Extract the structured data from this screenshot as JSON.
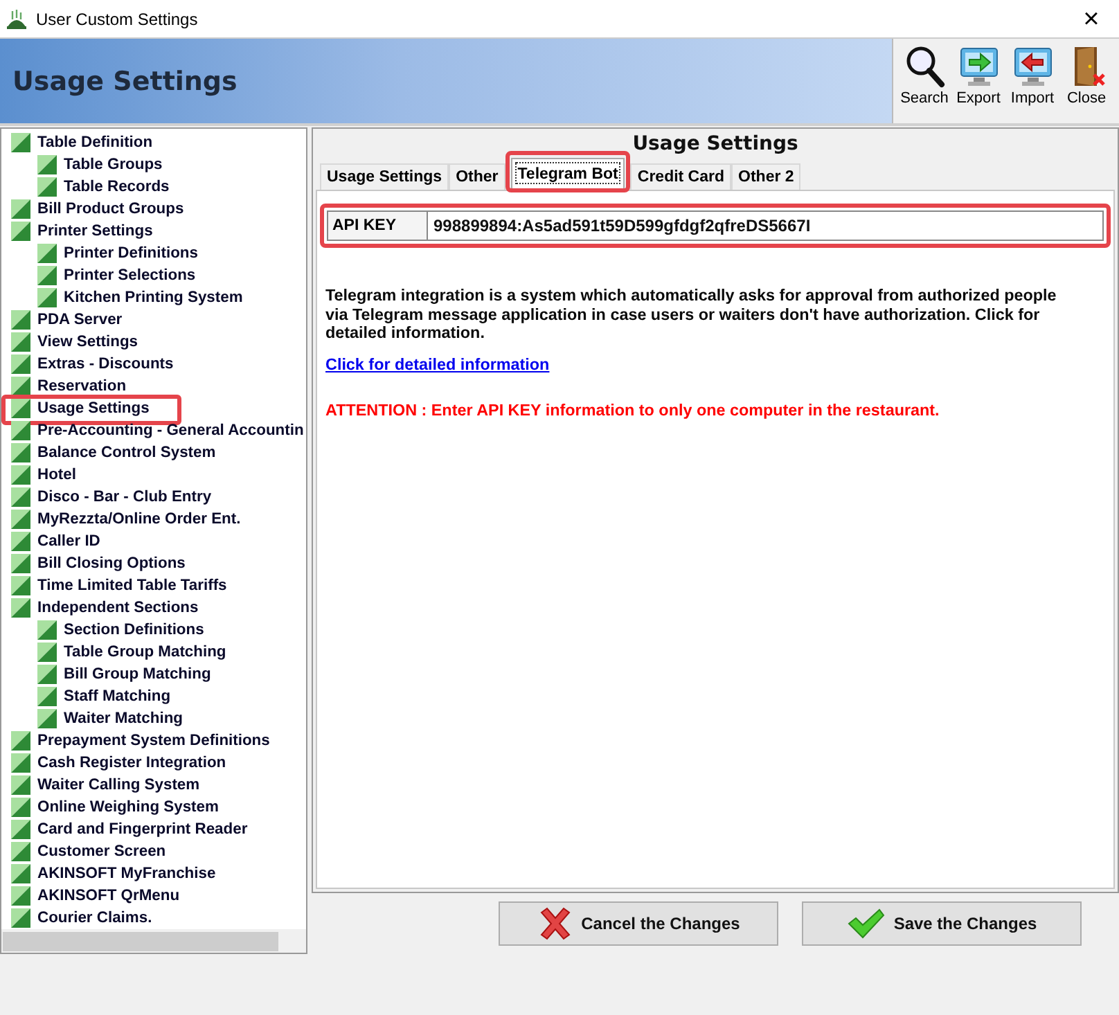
{
  "window": {
    "title": "User Custom Settings",
    "close": "×"
  },
  "header": {
    "title": "Usage Settings",
    "tools": [
      {
        "label": "Search",
        "kind": "search"
      },
      {
        "label": "Export",
        "kind": "export"
      },
      {
        "label": "Import",
        "kind": "import"
      },
      {
        "label": "Close",
        "kind": "close"
      }
    ]
  },
  "sidebar": {
    "items": [
      {
        "label": "Table Definition",
        "highlighted": false,
        "children": [
          {
            "label": "Table Groups",
            "highlighted": false
          },
          {
            "label": "Table Records",
            "highlighted": false
          }
        ]
      },
      {
        "label": "Bill Product Groups",
        "highlighted": false
      },
      {
        "label": "Printer Settings",
        "highlighted": false,
        "children": [
          {
            "label": "Printer Definitions",
            "highlighted": false
          },
          {
            "label": "Printer Selections",
            "highlighted": false
          },
          {
            "label": "Kitchen Printing System",
            "highlighted": false
          }
        ]
      },
      {
        "label": "PDA Server",
        "highlighted": false
      },
      {
        "label": "View Settings",
        "highlighted": false
      },
      {
        "label": "Extras - Discounts",
        "highlighted": false
      },
      {
        "label": "Reservation",
        "highlighted": false
      },
      {
        "label": "Usage Settings",
        "highlighted": true
      },
      {
        "label": "Pre-Accounting - General Accountin",
        "highlighted": false
      },
      {
        "label": "Balance Control System",
        "highlighted": false
      },
      {
        "label": "Hotel",
        "highlighted": false
      },
      {
        "label": "Disco - Bar - Club Entry",
        "highlighted": false
      },
      {
        "label": "MyRezzta/Online Order Ent.",
        "highlighted": false
      },
      {
        "label": "Caller ID",
        "highlighted": false
      },
      {
        "label": "Bill Closing Options",
        "highlighted": false
      },
      {
        "label": "Time Limited Table Tariffs",
        "highlighted": false
      },
      {
        "label": "Independent Sections",
        "highlighted": false,
        "children": [
          {
            "label": "Section Definitions",
            "highlighted": false
          },
          {
            "label": "Table Group Matching",
            "highlighted": false
          },
          {
            "label": "Bill Group Matching",
            "highlighted": false
          },
          {
            "label": "Staff Matching",
            "highlighted": false
          },
          {
            "label": "Waiter Matching",
            "highlighted": false
          }
        ]
      },
      {
        "label": "Prepayment System Definitions",
        "highlighted": false
      },
      {
        "label": "Cash Register Integration",
        "highlighted": false
      },
      {
        "label": "Waiter Calling System",
        "highlighted": false
      },
      {
        "label": "Online Weighing System",
        "highlighted": false
      },
      {
        "label": "Card and Fingerprint Reader",
        "highlighted": false
      },
      {
        "label": "Customer Screen",
        "highlighted": false
      },
      {
        "label": "AKINSOFT MyFranchise",
        "highlighted": false
      },
      {
        "label": "AKINSOFT QrMenu",
        "highlighted": false
      },
      {
        "label": "Courier Claims.",
        "highlighted": false
      }
    ]
  },
  "panel": {
    "title": "Usage Settings",
    "tabs": [
      {
        "label": "Usage Settings",
        "selected": false,
        "highlighted": false
      },
      {
        "label": "Other",
        "selected": false,
        "highlighted": false
      },
      {
        "label": "Telegram Bot",
        "selected": true,
        "highlighted": true
      },
      {
        "label": "Credit Card",
        "selected": false,
        "highlighted": false
      },
      {
        "label": "Other 2",
        "selected": false,
        "highlighted": false
      }
    ],
    "api_key": {
      "label": "API KEY",
      "value": "998899894:As5ad591t59D599gfdgf2qfreDS5667I",
      "highlighted": true
    },
    "description": "Telegram integration is a system which automatically asks for approval from authorized people via Telegram message application in case users or waiters don't have authorization. Click for detailed information.",
    "link": "Click for detailed information",
    "warning": "ATTENTION : Enter API KEY information to only one computer in the restaurant."
  },
  "buttons": [
    {
      "label": "Cancel the Changes",
      "kind": "cancel"
    },
    {
      "label": "Save the Changes",
      "kind": "save"
    }
  ]
}
